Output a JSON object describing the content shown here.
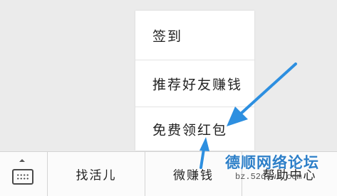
{
  "popup_menu": {
    "items": [
      {
        "label": "签到"
      },
      {
        "label": "推荐好友赚钱"
      },
      {
        "label": "免费领红包"
      }
    ]
  },
  "bottom_bar": {
    "keyboard_icon": "keyboard-icon",
    "tabs": [
      {
        "label": "找活儿"
      },
      {
        "label": "微赚钱"
      },
      {
        "label": "帮助中心"
      }
    ]
  },
  "watermark": {
    "title": "德顺网络论坛",
    "url": "bz.52dswl.com"
  },
  "colors": {
    "arrow": "#2d8fe0",
    "watermark": "#2d7fc8",
    "background": "#ebebeb",
    "menu_background": "#ffffff"
  }
}
